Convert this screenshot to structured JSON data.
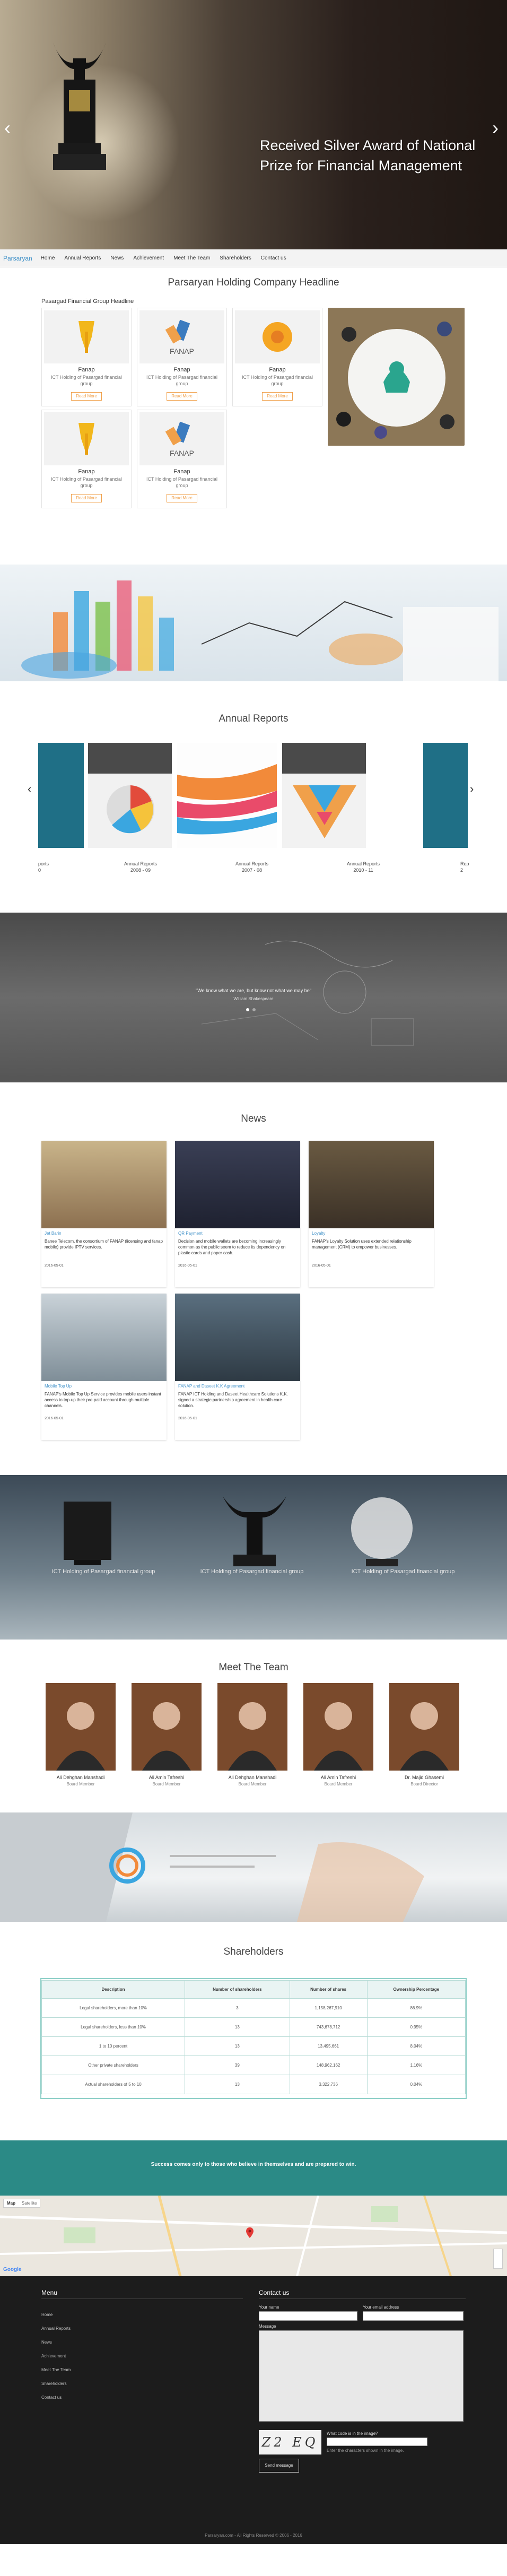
{
  "hero": {
    "title": "Received Silver Award of National Prize for Financial Management",
    "prev": "‹",
    "next": "›"
  },
  "nav": {
    "brand": "Parsaryan",
    "items": [
      "Home",
      "Annual Reports",
      "News",
      "Achievement",
      "Meet The Team",
      "Shareholders",
      "Contact us"
    ]
  },
  "companies": {
    "title": "Parsaryan Holding Company Headline",
    "subtitle": "Pasargad Financial Group Headline",
    "cards": [
      {
        "name": "Fanap",
        "desc": "ICT Holding of Pasargad financial group",
        "btn": "Read More",
        "logo": "sunflower"
      },
      {
        "name": "Fanap",
        "desc": "ICT Holding of Pasargad financial group",
        "btn": "Read More",
        "logo": "fanap"
      },
      {
        "name": "Fanap",
        "desc": "ICT Holding of Pasargad financial group",
        "btn": "Read More",
        "logo": "orange-flower"
      },
      {
        "name": "Fanap",
        "desc": "ICT Holding of Pasargad financial group",
        "btn": "Read More",
        "logo": "sunflower"
      },
      {
        "name": "Fanap",
        "desc": "ICT Holding of Pasargad financial group",
        "btn": "Read More",
        "logo": "fanap"
      }
    ]
  },
  "reports": {
    "title": "Annual Reports",
    "items": [
      {
        "label": "Annual Reports",
        "year": "2008 - 09"
      },
      {
        "label": "Annual Reports",
        "year": "2007 - 08"
      },
      {
        "label": "Annual Reports",
        "year": "2010 - 11"
      }
    ],
    "edge_left": "ports",
    "edge_left_year": "0",
    "edge_right": "Rep",
    "edge_right_year": "2"
  },
  "quote": {
    "text": "\"We know what we are, but know not what we may be\"",
    "author": "William Shakespeare"
  },
  "news": {
    "title": "News",
    "items": [
      {
        "cat": "Jet Barin",
        "text": "Banee Telecom, the consortium of FANAP (licensing and fanap mobile) provide IPTV services.",
        "date": "2016-05-01"
      },
      {
        "cat": "QR Payment",
        "text": "Decision and mobile wallets are becoming increasingly common as the public seem to reduce its dependency on plastic cards and paper cash.",
        "date": "2016-05-01"
      },
      {
        "cat": "Loyalty",
        "text": "FANAP's Loyalty Solution uses extended relationship management (CRM) to empower businesses.",
        "date": "2016-05-01"
      },
      {
        "cat": "Mobile Top Up",
        "text": "FANAP's Mobile Top Up Service provides mobile users instant access to top-up their pre-paid account through multiple channels.",
        "date": "2016-05-01"
      },
      {
        "cat": "FANAP and Daseet K.K Agreement",
        "text": "FANAP ICT Holding and Daseet Healthcare Solutions K.K. signed a strategic partnership agreement in health care solution.",
        "date": "2016-05-01"
      }
    ]
  },
  "awards": {
    "items": [
      "ICT Holding of Pasargad financial group",
      "ICT Holding of Pasargad financial group",
      "ICT Holding of Pasargad financial group"
    ]
  },
  "team": {
    "title": "Meet The Team",
    "members": [
      {
        "name": "Ali Dehghan Manshadi",
        "role": "Board Member"
      },
      {
        "name": "Ali Amin Tafreshi",
        "role": "Board Member"
      },
      {
        "name": "Ali Dehghan Manshadi",
        "role": "Board Member"
      },
      {
        "name": "Ali Amin Tafreshi",
        "role": "Board Member"
      },
      {
        "name": "Dr. Majid Ghasemi",
        "role": "Board Director"
      }
    ]
  },
  "shareholders": {
    "title": "Shareholders",
    "headers": [
      "Description",
      "Number of shareholders",
      "Number of shares",
      "Ownership Percentage"
    ],
    "rows": [
      [
        "Legal shareholders, more than 10%",
        "3",
        "1,158,267,910",
        "86.9%"
      ],
      [
        "Legal shareholders, less than 10%",
        "13",
        "743,678,712",
        "0.95%"
      ],
      [
        "1 to 10 percent",
        "13",
        "13,495,661",
        "8.04%"
      ],
      [
        "Other private shareholders",
        "39",
        "148,962,162",
        "1.16%"
      ],
      [
        "Actual shareholders of 5 to 10",
        "13",
        "3,322,736",
        "0.04%"
      ]
    ]
  },
  "banner": {
    "text": "Success comes only to those who believe in themselves and are prepared to win."
  },
  "map": {
    "tab_map": "Map",
    "tab_sat": "Satellite",
    "google": "Google"
  },
  "footer": {
    "menu_title": "Menu",
    "menu": [
      "Home",
      "Annual Reports",
      "News",
      "Achievement",
      "Meet The Team",
      "Shareholders",
      "Contact us"
    ],
    "contact_title": "Contact us",
    "name_label": "Your name",
    "email_label": "Your email address",
    "message_label": "Message",
    "captcha_label": "What code is in the image?",
    "captcha_text": "Z2 EQ",
    "captcha_help": "Enter the characters shown in the image.",
    "send": "Send message",
    "copyright": "Parsaryan.com - All Rights Reserved © 2006 - 2016"
  },
  "colors": {
    "accent": "#3d8fc7",
    "teal": "#2b8a86",
    "orange": "#f0a04a"
  }
}
